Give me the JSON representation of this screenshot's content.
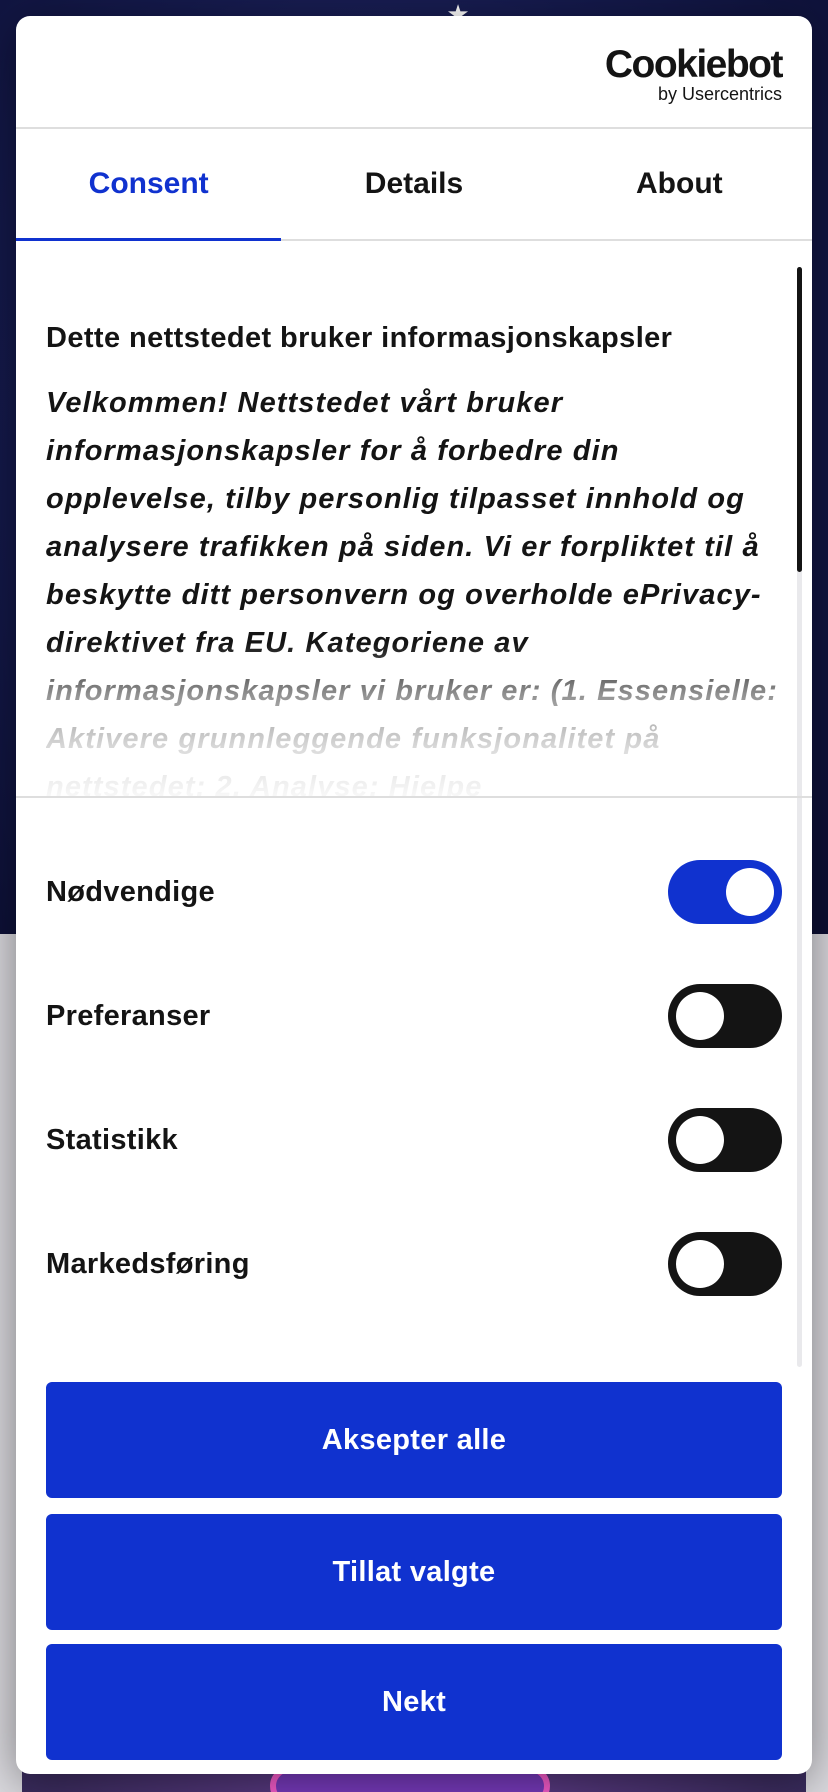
{
  "background": {
    "accent_dark": "#151a4d"
  },
  "dialog": {
    "logo": {
      "main": "Cookiebot",
      "sub": "by Usercentrics"
    },
    "tabs": [
      {
        "label": "Consent",
        "active": true
      },
      {
        "label": "Details",
        "active": false
      },
      {
        "label": "About",
        "active": false
      }
    ],
    "title": "Dette nettstedet bruker informasjonskapsler",
    "body": "Velkommen! Nettstedet vårt bruker informasjonskapsler for å forbedre din opplevelse, tilby personlig tilpasset innhold og analysere trafikken på siden. Vi er forpliktet til å beskytte ditt personvern og overholde ePrivacy-direktivet fra EU. Kategoriene av informasjonskapsler vi bruker er: (1. Essensielle: Aktivere grunnleggende funksjonalitet på nettstedet; 2. Analyse: Hjelpe",
    "toggles": [
      {
        "label": "Nødvendige",
        "on": true
      },
      {
        "label": "Preferanser",
        "on": false
      },
      {
        "label": "Statistikk",
        "on": false
      },
      {
        "label": "Markedsføring",
        "on": false
      }
    ],
    "buttons": {
      "accept_all": "Aksepter alle",
      "allow_selected": "Tillat valgte",
      "deny": "Nekt"
    },
    "colors": {
      "accent": "#1032cf",
      "text": "#141414",
      "switch_off": "#141414"
    }
  }
}
